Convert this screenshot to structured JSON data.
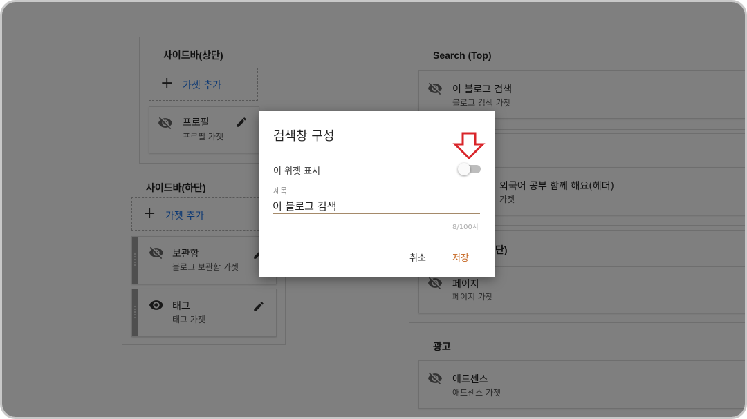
{
  "left_top_panel": {
    "title": "사이드바(상단)",
    "add_label": "가젯 추가",
    "gadgets": [
      {
        "name": "프로필",
        "sub": "프로필 가젯",
        "visible": false
      }
    ]
  },
  "left_bottom_panel": {
    "title": "사이드바(하단)",
    "add_label": "가젯 추가",
    "gadgets": [
      {
        "name": "보관함",
        "sub": "블로그 보관함 가젯",
        "visible": false
      },
      {
        "name": "태그",
        "sub": "태그 가젯",
        "visible": true
      }
    ]
  },
  "right_panels": {
    "search": {
      "title": "Search (Top)",
      "gadget": {
        "name": "이 블로그 검색",
        "sub": "블로그 검색 가젯"
      }
    },
    "header": {
      "gadget": {
        "name": "외국어 공부 함께 해요(헤더)",
        "sub": "가젯"
      }
    },
    "pages": {
      "title_fragment": "단)",
      "gadget": {
        "name": "페이지",
        "sub": "페이지 가젯"
      }
    },
    "ads": {
      "title": "광고",
      "gadget": {
        "name": "애드센스",
        "sub": "애드센스 가젯"
      }
    }
  },
  "dialog": {
    "title": "검색창 구성",
    "toggle_label": "이 위젯 표시",
    "toggle_on": false,
    "field_label": "제목",
    "field_value": "이 블로그 검색",
    "char_count": "8/100자",
    "cancel_label": "취소",
    "save_label": "저장"
  },
  "colors": {
    "accent_link": "#1a73e8",
    "save_text": "#c5651f",
    "arrow": "#d9252a",
    "overlay": "rgba(0,0,0,0.5)"
  },
  "icons": {
    "hidden": "eye-off-icon",
    "visible": "eye-icon",
    "edit": "pencil-icon",
    "add": "plus-icon"
  }
}
